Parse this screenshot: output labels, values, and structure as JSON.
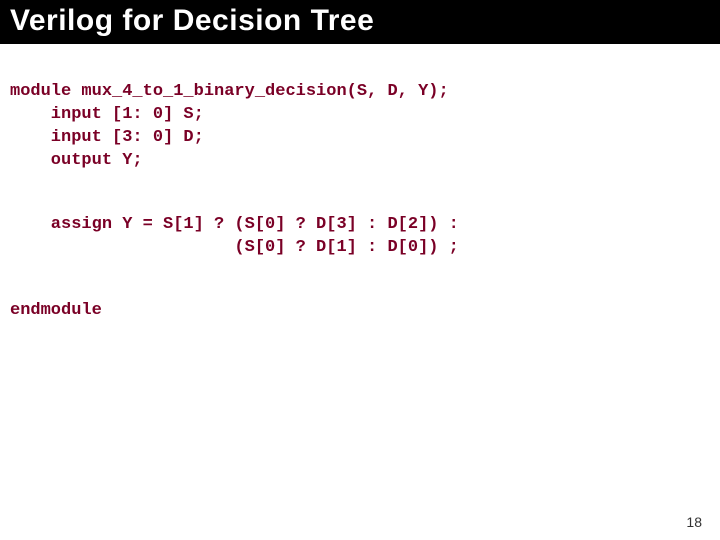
{
  "title": "Verilog for Decision Tree",
  "page": "18",
  "code": {
    "l1": "module mux_4_to_1_binary_decision(S, D, Y);",
    "l2": "    input [1: 0] S;",
    "l3": "    input [3: 0] D;",
    "l4": "    output Y;",
    "l5": "    assign Y = S[1] ? (S[0] ? D[3] : D[2]) :",
    "l6": "                      (S[0] ? D[1] : D[0]) ;",
    "l7": "endmodule"
  }
}
